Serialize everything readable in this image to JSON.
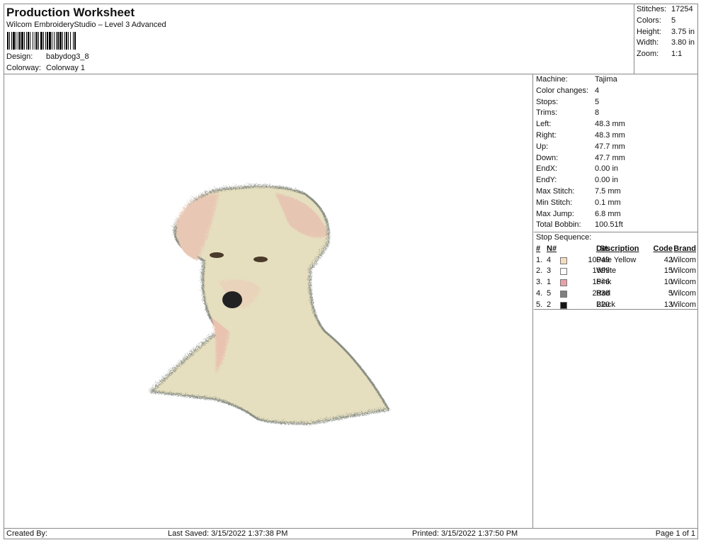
{
  "header": {
    "title": "Production Worksheet",
    "subtitle": "Wilcom EmbroideryStudio – Level 3 Advanced",
    "design_label": "Design:",
    "design_value": "babydog3_8",
    "colorway_label": "Colorway:",
    "colorway_value": "Colorway 1"
  },
  "stats": [
    {
      "label": "Stitches:",
      "value": "17254"
    },
    {
      "label": "Colors:",
      "value": "5"
    },
    {
      "label": "Height:",
      "value": "3.75 in"
    },
    {
      "label": "Width:",
      "value": "3.80 in"
    },
    {
      "label": "Zoom:",
      "value": "1:1"
    }
  ],
  "info": [
    {
      "label": "Machine:",
      "value": "Tajima"
    },
    {
      "label": "Color changes:",
      "value": "4"
    },
    {
      "label": "Stops:",
      "value": "5"
    },
    {
      "label": "Trims:",
      "value": "8"
    },
    {
      "label": "Left:",
      "value": "48.3 mm"
    },
    {
      "label": "Right:",
      "value": "48.3 mm"
    },
    {
      "label": "Up:",
      "value": "47.7 mm"
    },
    {
      "label": "Down:",
      "value": "47.7 mm"
    },
    {
      "label": "EndX:",
      "value": "0.00 in"
    },
    {
      "label": "EndY:",
      "value": "0.00 in"
    },
    {
      "label": "Max Stitch:",
      "value": "7.5 mm"
    },
    {
      "label": "Min Stitch:",
      "value": "0.1 mm"
    },
    {
      "label": "Max Jump:",
      "value": "6.8 mm"
    },
    {
      "label": "Total Bobbin:",
      "value": "100.51ft"
    }
  ],
  "stop_sequence": {
    "title": "Stop Sequence:",
    "headers": [
      "#",
      "N#",
      "St.",
      "Description",
      "Code",
      "Brand"
    ],
    "rows": [
      {
        "num": "1.",
        "n": "4",
        "color": "#f5dcc0",
        "st": "10949",
        "desc": "Pale Yellow",
        "code": "42",
        "brand": "Wilcom"
      },
      {
        "num": "2.",
        "n": "3",
        "color": "#ffffff",
        "st": "1699",
        "desc": "White",
        "code": "15",
        "brand": "Wilcom"
      },
      {
        "num": "3.",
        "n": "1",
        "color": "#e8a0a8",
        "st": "1546",
        "desc": "Pink",
        "code": "10",
        "brand": "Wilcom"
      },
      {
        "num": "4.",
        "n": "5",
        "color": "#808080",
        "st": "2838",
        "desc": "Red",
        "code": "5",
        "brand": "Wilcom"
      },
      {
        "num": "5.",
        "n": "2",
        "color": "#151515",
        "st": "220",
        "desc": "Black",
        "code": "13",
        "brand": "Wilcom"
      }
    ]
  },
  "footer": {
    "created": "Created By:",
    "saved": "Last Saved: 3/15/2022 1:37:38 PM",
    "printed": "Printed: 3/15/2022 1:37:50 PM",
    "page": "Page 1 of 1"
  }
}
